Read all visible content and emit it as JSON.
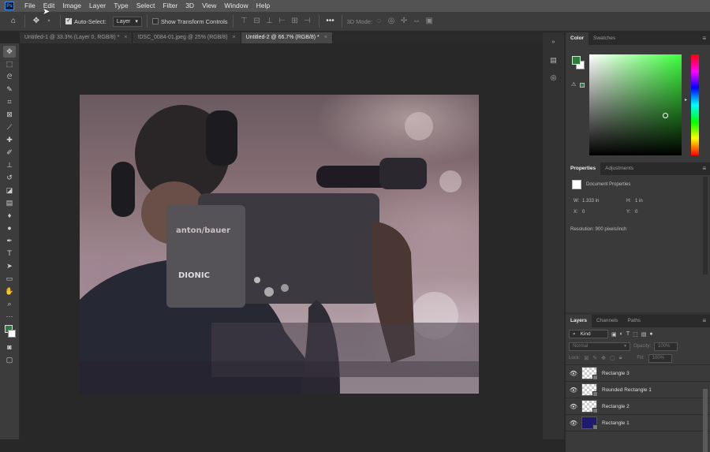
{
  "app": {
    "logo": "Ps"
  },
  "menu": [
    "File",
    "Edit",
    "Image",
    "Layer",
    "Type",
    "Select",
    "Filter",
    "3D",
    "View",
    "Window",
    "Help"
  ],
  "options": {
    "auto_select_label": "Auto-Select:",
    "auto_select_value": "Layer",
    "transform_label": "Show Transform Controls",
    "mode_label": "3D Mode:"
  },
  "tabs": [
    {
      "label": "Untitled-1 @ 33.3% (Layer 0, RGB/8) *"
    },
    {
      "label": "!DSC_0084-01.jpeg @ 25% (RGB/8)"
    },
    {
      "label": "Untitled-2 @ 66.7% (RGB/8) *"
    }
  ],
  "color_panel": {
    "tabs": [
      "Color",
      "Swatches"
    ],
    "foreground": "#2e7d3a",
    "background": "#ffffff",
    "accent_green": "#5cff5c"
  },
  "properties_panel": {
    "tabs": [
      "Properties",
      "Adjustments"
    ],
    "title": "Document Properties",
    "w_label": "W:",
    "w_value": "1.333 in",
    "h_label": "H:",
    "h_value": "1 in",
    "x_label": "X:",
    "x_value": "0",
    "y_label": "Y:",
    "y_value": "0",
    "resolution": "Resolution: 900 pixels/inch"
  },
  "layers_panel": {
    "tabs": [
      "Layers",
      "Channels",
      "Paths"
    ],
    "kind_label": "Kind",
    "blend_mode": "Normal",
    "opacity_label": "Opacity:",
    "opacity_value": "100%",
    "lock_label": "Lock:",
    "fill_label": "Fill:",
    "fill_value": "100%",
    "layers": [
      {
        "name": "Rectangle 3"
      },
      {
        "name": "Rounded Rectangle 1"
      },
      {
        "name": "Rectangle 2"
      },
      {
        "name": "Rectangle 1"
      }
    ]
  },
  "canvas": {
    "overlay_color": "#463e48"
  }
}
